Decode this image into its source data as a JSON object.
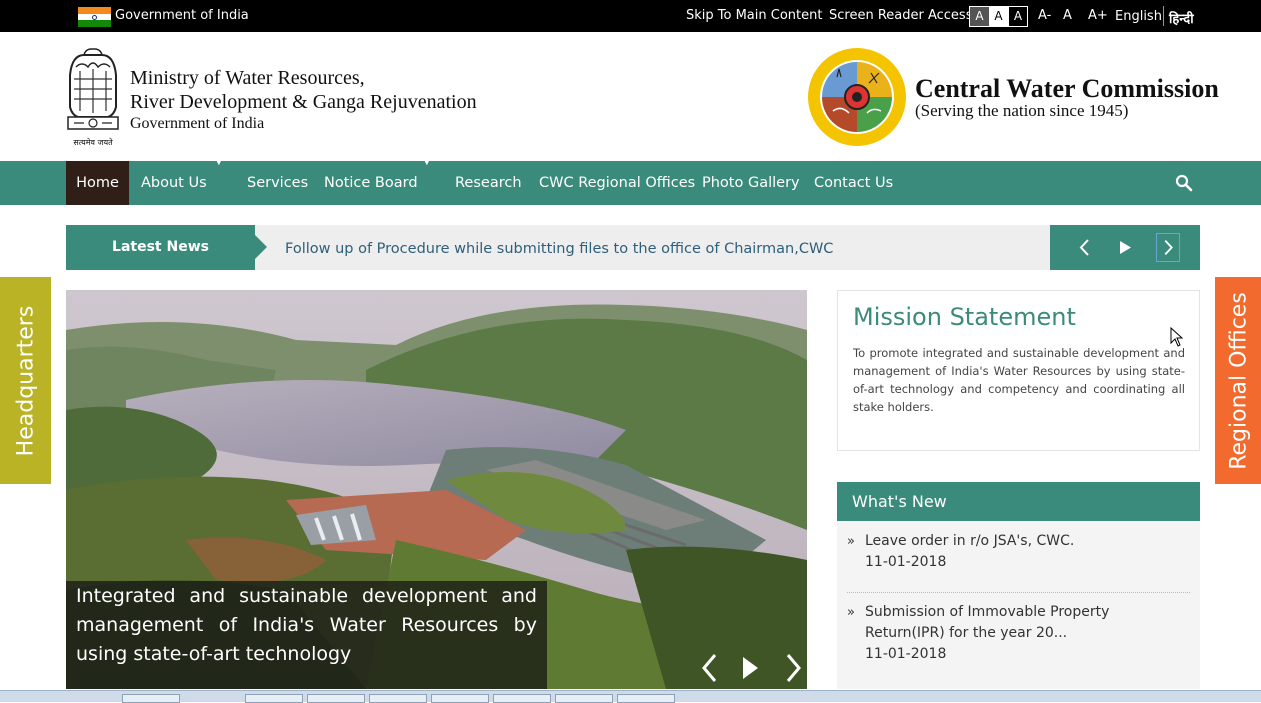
{
  "topbar": {
    "gov_label": "Government of India",
    "skip_label": "Skip To Main Content",
    "screen_reader_label": "Screen Reader Access",
    "contrast_options": [
      "A",
      "A",
      "A"
    ],
    "font_decrease": "A-",
    "font_normal": "A",
    "font_increase": "A+",
    "lang_english": "English",
    "lang_hindi": "हिन्दी"
  },
  "header": {
    "emblem_motto": "सत्यमेव जयते",
    "ministry_line1": "Ministry of Water Resources,",
    "ministry_line2": "River Development & Ganga Rejuvenation",
    "ministry_line3": "Government of India",
    "cwc_title": "Central Water Commission",
    "cwc_subtitle": "(Serving the nation since 1945)"
  },
  "nav": {
    "items": [
      "Home",
      "About Us",
      "Services",
      "Notice Board",
      "Research",
      "CWC Regional Offices",
      "Photo Gallery",
      "Contact Us"
    ],
    "active": "Home"
  },
  "news": {
    "label": "Latest News",
    "text": "Follow up of Procedure while submitting files to the office of Chairman,CWC"
  },
  "side_tabs": {
    "left": "Headquarters",
    "right": "Regional Offices"
  },
  "slider": {
    "caption": "Integrated and sustainable development and management of India's Water Resources by using state-of-art technology"
  },
  "mission": {
    "title": "Mission Statement",
    "body": "To promote integrated and sustainable development and management of India's Water Resources by using state-of-art technology and competency and coordinating all stake holders."
  },
  "whats_new": {
    "title": "What's New",
    "items": [
      {
        "text": "Leave order in r/o JSA's, CWC.",
        "date": "11-01-2018"
      },
      {
        "text": "Submission of Immovable Property Return(IPR) for the year 20...",
        "date": "11-01-2018"
      }
    ]
  },
  "colors": {
    "teal": "#3a8b7b",
    "home_active": "#2f1f17",
    "headquarters_tab": "#b9b325",
    "regional_tab": "#f26a2d",
    "news_text": "#2e5f7a"
  },
  "icons": [
    "search-icon",
    "prev-icon",
    "play-icon",
    "next-icon"
  ]
}
